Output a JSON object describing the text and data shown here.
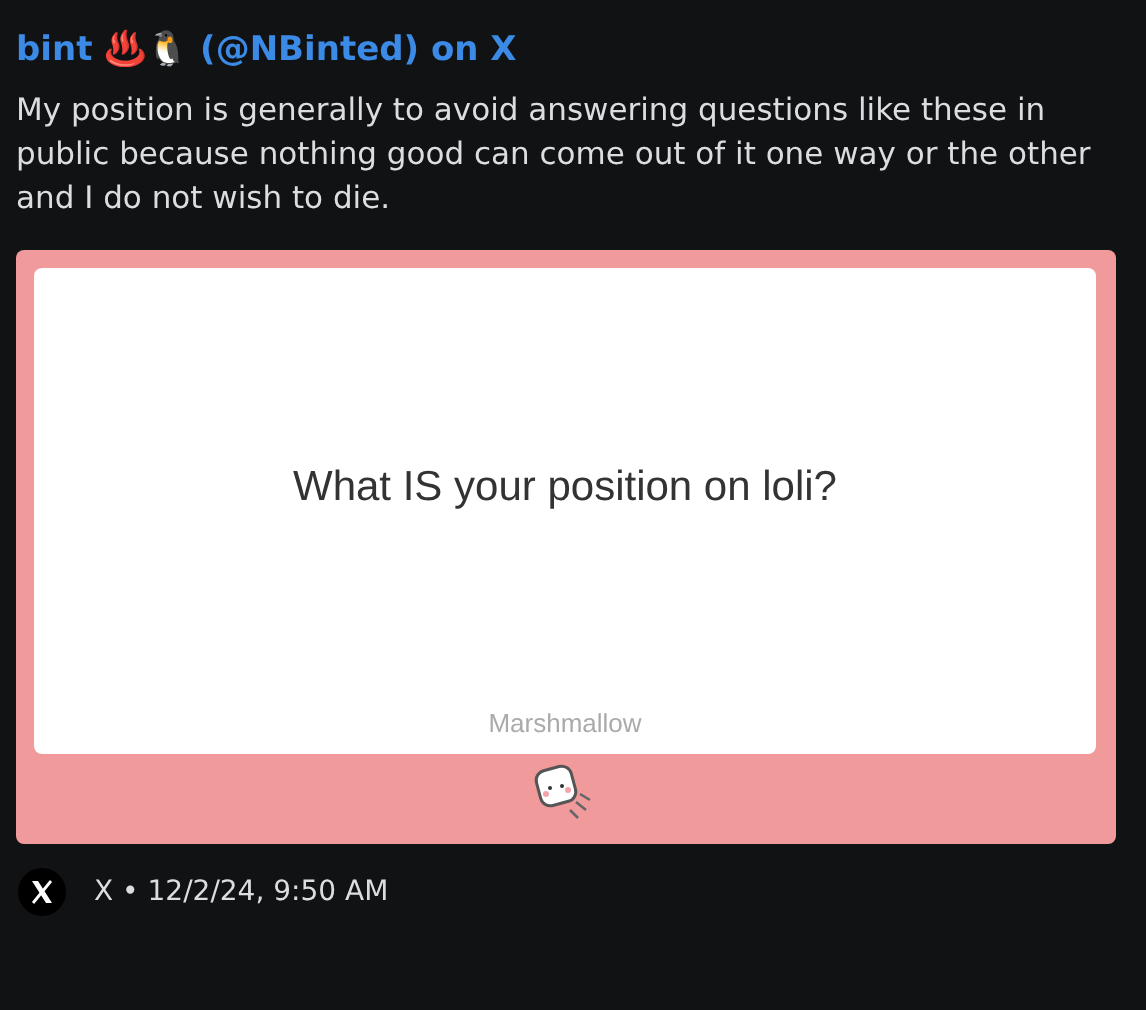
{
  "embed": {
    "title": "bint ♨️🐧 (@NBinted) on X",
    "description": "My position is generally to avoid answering questions like these in public because nothing good can come out of it one way or the other and I do not wish to die.",
    "image": {
      "question": "What IS your position on loli?",
      "brand": "Marshmallow"
    },
    "footer": {
      "source": "X • 12/2/24, 9:50 AM"
    }
  }
}
